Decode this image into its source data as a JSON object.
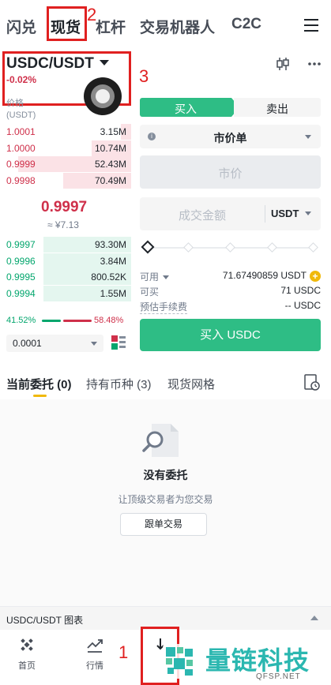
{
  "top_tabs": [
    "闪兑",
    "现货",
    "杠杆",
    "交易机器人",
    "C2C"
  ],
  "pair": {
    "name": "USDC/USDT",
    "change": "-0.02%"
  },
  "orderbook": {
    "price_label": "价格",
    "price_unit": "(USDT)",
    "asks": [
      {
        "price": "1.0001",
        "amount": "3.15M",
        "depth": 0.08
      },
      {
        "price": "1.0000",
        "amount": "10.74M",
        "depth": 0.3
      },
      {
        "price": "0.9999",
        "amount": "52.43M",
        "depth": 0.86
      },
      {
        "price": "0.9998",
        "amount": "70.49M",
        "depth": 0.52
      }
    ],
    "mid_price": "0.9997",
    "mid_cny": "≈ ¥7.13",
    "bids": [
      {
        "price": "0.9997",
        "amount": "93.30M",
        "depth": 0.67
      },
      {
        "price": "0.9996",
        "amount": "3.84M",
        "depth": 0.67
      },
      {
        "price": "0.9995",
        "amount": "800.52K",
        "depth": 0.67
      },
      {
        "price": "0.9994",
        "amount": "1.55M",
        "depth": 0.67
      }
    ],
    "buy_ratio": "41.52%",
    "sell_ratio": "58.48%",
    "precision": "0.0001"
  },
  "trade": {
    "buy_tab": "买入",
    "sell_tab": "卖出",
    "order_type": "市价单",
    "price_placeholder": "市价",
    "amount_placeholder": "成交金额",
    "amount_unit": "USDT",
    "available_label": "可用",
    "available_value": "71.67490859 USDT",
    "can_buy_label": "可买",
    "can_buy_value": "71 USDC",
    "fee_label": "预估手续费",
    "fee_value": "-- USDC",
    "buy_button": "买入 USDC"
  },
  "orders": {
    "tabs": [
      "当前委托 (0)",
      "持有币种 (3)",
      "现货网格"
    ],
    "empty_title": "没有委托",
    "empty_sub": "让顶级交易者为您交易",
    "copy_button": "跟单交易"
  },
  "chart_bar": "USDC/USDT 图表",
  "bottom_nav": [
    "首页",
    "行情"
  ],
  "annotations": [
    "1",
    "2",
    "3"
  ],
  "watermark": {
    "text": "量链科技",
    "url": "QFSP.NET"
  },
  "colors": {
    "buy": "#2ebd85",
    "sell": "#cf304a",
    "accent": "#f0b90b",
    "annotation": "#e02020"
  }
}
